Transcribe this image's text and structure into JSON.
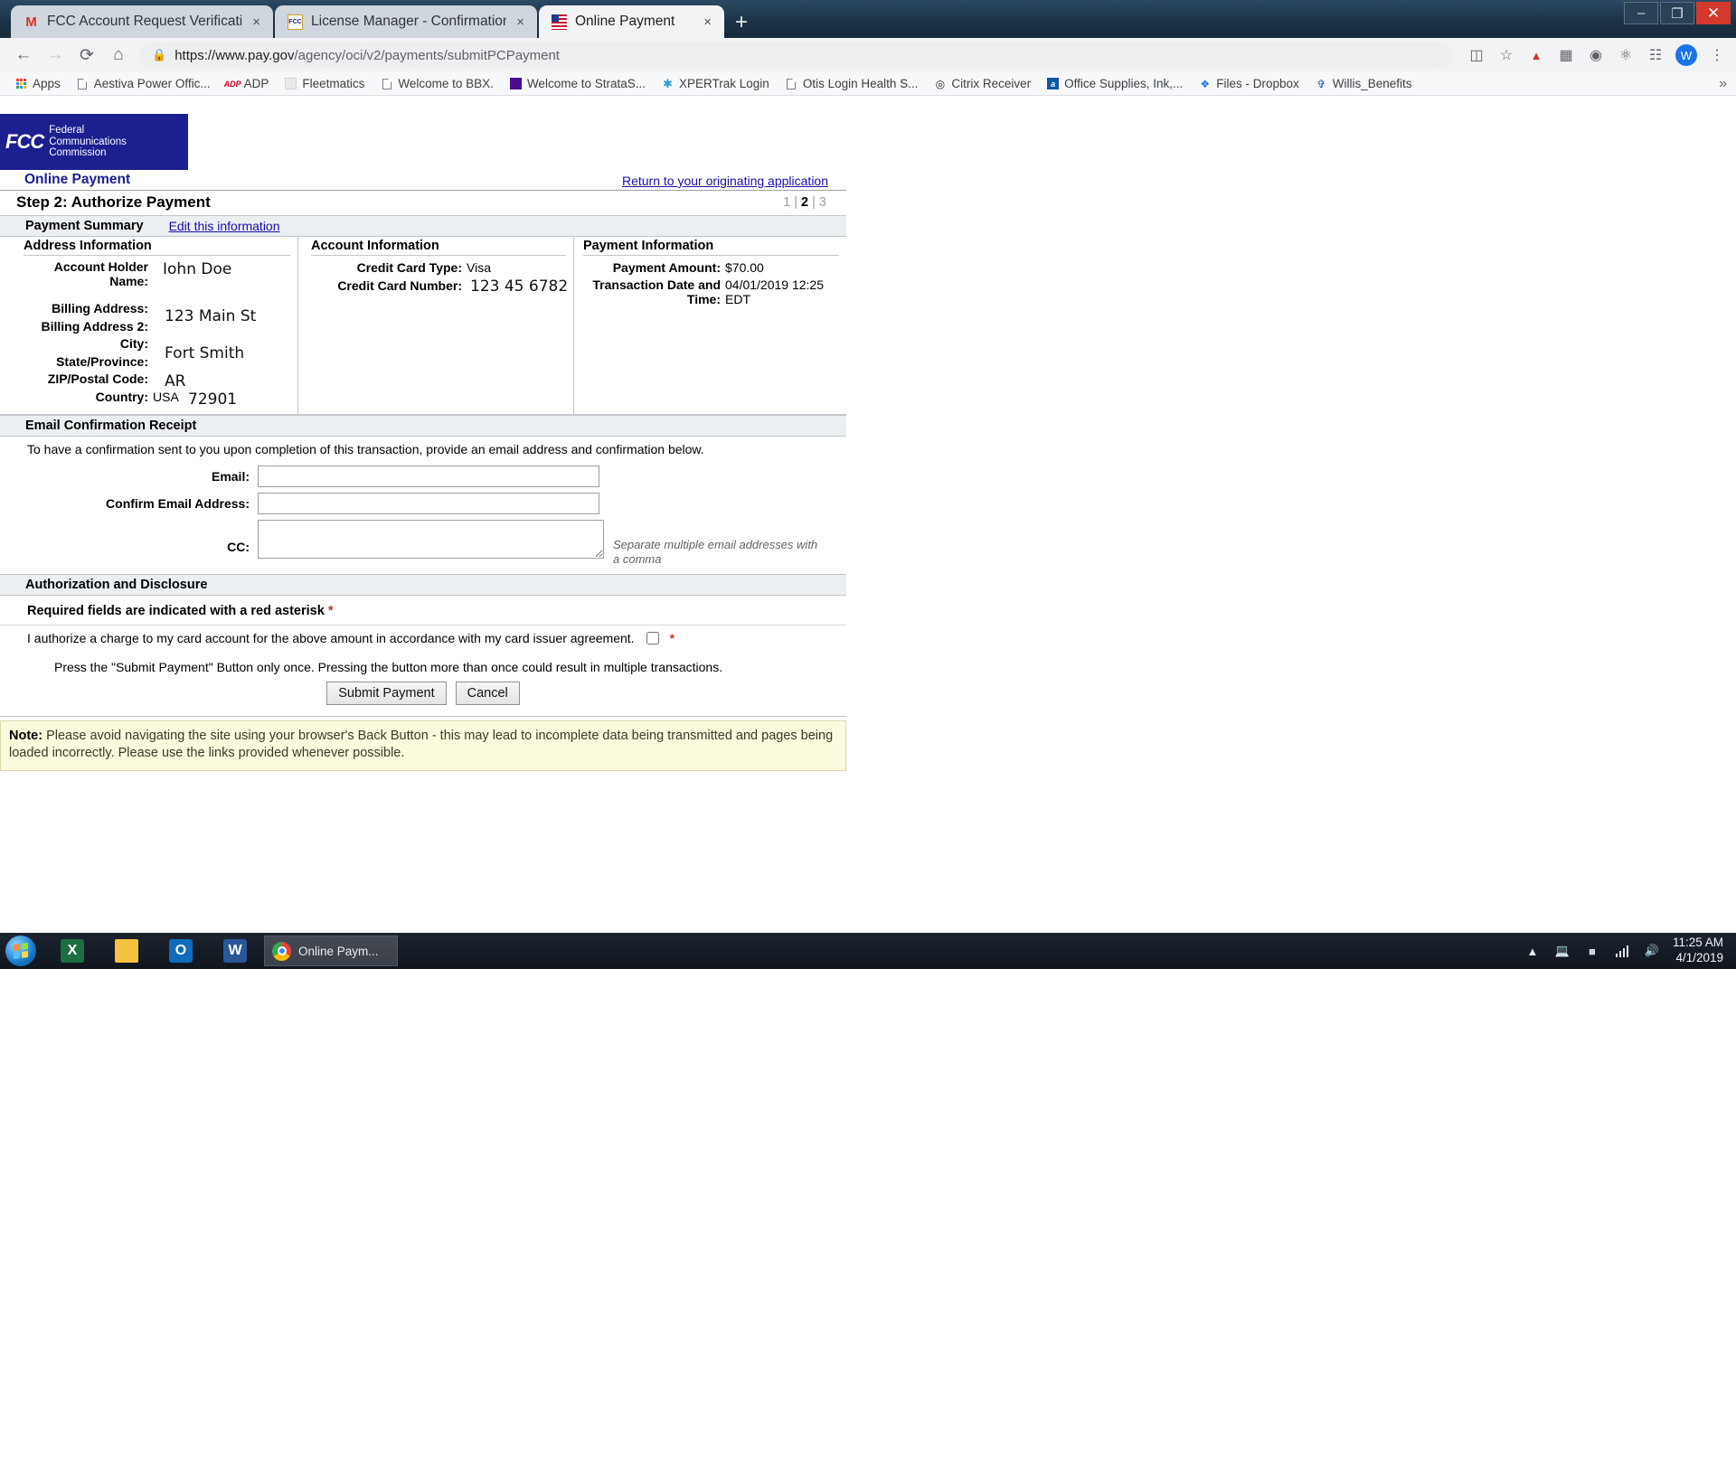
{
  "browser": {
    "tabs": [
      {
        "title": "FCC Account Request Verification",
        "icon": "gmail-icon",
        "active": false,
        "close": "×"
      },
      {
        "title": "License Manager - Confirmation",
        "icon": "fcc-icon",
        "active": false,
        "close": "×"
      },
      {
        "title": "Online Payment",
        "icon": "us-flag-icon",
        "active": true,
        "close": "×"
      }
    ],
    "new_tab_label": "+",
    "window_controls": {
      "minimize": "–",
      "maximize": "❐",
      "close": "✕"
    },
    "nav": {
      "back": "←",
      "forward": "→",
      "reload": "⟳",
      "home": "⌂"
    },
    "omnibox": {
      "lock": "ὑ2",
      "url_domain": "https://www.pay.gov",
      "url_path": "/agency/oci/v2/payments/submitPCPayment"
    },
    "toolbar_icons": [
      "card-icon",
      "star-icon",
      "pdf-icon",
      "puzzle-icon",
      "circle-icon",
      "at-icon",
      "grid-icon"
    ],
    "profile_initial": "W",
    "menu_icon": "⋮",
    "bookmarks": [
      {
        "label": "Apps",
        "icon": "apps-grid-icon"
      },
      {
        "label": "Aestiva Power Offic...",
        "icon": "page-icon"
      },
      {
        "label": "ADP",
        "icon": "adp-icon"
      },
      {
        "label": "Fleetmatics",
        "icon": "fleetmatics-icon"
      },
      {
        "label": "Welcome to BBX.",
        "icon": "page-icon"
      },
      {
        "label": "Welcome to StrataS...",
        "icon": "purple-square-icon"
      },
      {
        "label": "XPERTrak Login",
        "icon": "star-burst-icon"
      },
      {
        "label": "Otis Login Health S...",
        "icon": "page-icon"
      },
      {
        "label": "Citrix Receiver",
        "icon": "citrix-icon"
      },
      {
        "label": "Office Supplies, Ink,...",
        "icon": "office-depot-icon"
      },
      {
        "label": "Files - Dropbox",
        "icon": "dropbox-icon"
      },
      {
        "label": "Willis_Benefits",
        "icon": "willis-icon"
      }
    ],
    "bookmarks_overflow": "»"
  },
  "page": {
    "agency": {
      "mark": "FCC",
      "line1": "Federal",
      "line2": "Communications",
      "line3": "Commission"
    },
    "header": {
      "title": "Online Payment",
      "return_link": "Return to your originating application"
    },
    "step": {
      "title": "Step 2: Authorize Payment",
      "indicator_1": "1",
      "sep1": "|",
      "indicator_2": "2",
      "sep2": "|",
      "indicator_3": "3"
    },
    "summary_header": {
      "title": "Payment Summary",
      "edit_link": "Edit this information"
    },
    "address_information": {
      "title": "Address Information",
      "fields": [
        {
          "label": "Account Holder Name:",
          "value": ""
        },
        {
          "label": "Billing Address:",
          "value": ""
        },
        {
          "label": "Billing Address 2:",
          "value": ""
        },
        {
          "label": "City:",
          "value": ""
        },
        {
          "label": "State/Province:",
          "value": ""
        },
        {
          "label": "ZIP/Postal Code:",
          "value": ""
        },
        {
          "label": "Country:",
          "value": "USA"
        }
      ],
      "overlay_values": {
        "account_holder_name": "Iohn Doe",
        "billing_address": "123 Main St",
        "city": "Fort Smith",
        "state_province": "AR",
        "zip_postal_code": "72901"
      }
    },
    "account_information": {
      "title": "Account Information",
      "fields": [
        {
          "label": "Credit Card Type:",
          "value": "Visa"
        },
        {
          "label": "Credit Card Number:",
          "value": ""
        }
      ],
      "overlay_values": {
        "credit_card_number": "123 45 6782"
      }
    },
    "payment_information": {
      "title": "Payment Information",
      "fields": [
        {
          "label": "Payment Amount:",
          "value": "$70.00"
        },
        {
          "label": "Transaction Date and Time:",
          "value": "04/01/2019 12:25 EDT"
        }
      ]
    },
    "email_receipt": {
      "section_title": "Email Confirmation Receipt",
      "blurb": "To have a confirmation sent to you upon completion of this transaction, provide an email address and confirmation below.",
      "email_label": "Email:",
      "email_value": "",
      "confirm_label": "Confirm Email Address:",
      "confirm_value": "",
      "cc_label": "CC:",
      "cc_value": "",
      "cc_hint": "Separate multiple email addresses with a comma"
    },
    "authorization": {
      "section_title": "Authorization and Disclosure",
      "required_text": "Required fields are indicated with a red asterisk",
      "required_asterisk": "*",
      "authorize_text": "I authorize a charge to my card account for the above amount in accordance with my card issuer agreement.",
      "authorize_asterisk": "*",
      "authorize_checked": false,
      "press_text": "Press the \"Submit Payment\" Button only once. Pressing the button more than once could result in multiple transactions.",
      "submit_label": "Submit Payment",
      "cancel_label": "Cancel"
    },
    "note": {
      "prefix": "Note:",
      "text": " Please avoid navigating the site using your browser's Back Button - this may lead to incomplete data being transmitted and pages being loaded incorrectly. Please use the links provided whenever possible."
    }
  },
  "taskbar": {
    "start": "start-orb",
    "pinned": [
      {
        "name": "excel-icon",
        "glyph": "X"
      },
      {
        "name": "file-explorer-icon",
        "glyph": ""
      },
      {
        "name": "outlook-icon",
        "glyph": "O"
      },
      {
        "name": "word-icon",
        "glyph": "W"
      }
    ],
    "running": {
      "label": "Online Paym...",
      "icon": "chrome-icon"
    },
    "tray": {
      "overflow": "▲",
      "network": "network-icon",
      "battery": "battery-icon",
      "signal": "signal-icon",
      "volume": "🔊"
    },
    "clock": {
      "time": "11:25 AM",
      "date": "4/1/2019"
    }
  },
  "colors": {
    "fcc_blue": "#1b1f8f",
    "link_blue": "#1a0dab",
    "required_red": "#c0392b",
    "note_bg": "#fcfbdd",
    "section_bg": "#eceff1"
  }
}
